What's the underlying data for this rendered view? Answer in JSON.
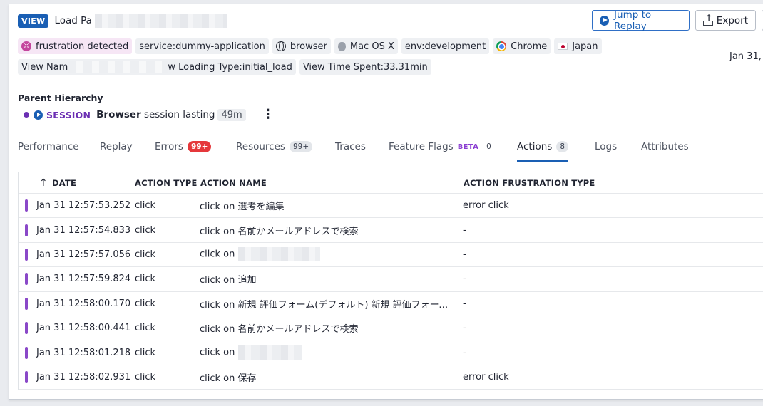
{
  "header": {
    "badge": "VIEW",
    "title": "Load Pa",
    "jump_to_replay": "Jump to Replay",
    "export": "Export",
    "date_right": "Jan 31, "
  },
  "tags_row1": [
    {
      "label": "frustration detected",
      "icon": "frustration-face-icon"
    },
    {
      "label": "service:dummy-application"
    },
    {
      "label": "browser",
      "icon": "globe-icon"
    },
    {
      "label": "Mac OS X",
      "icon": "apple-icon"
    },
    {
      "label": "env:development"
    },
    {
      "label": "Chrome",
      "icon": "chrome-icon"
    },
    {
      "label": "Japan",
      "icon": "japan-flag-icon"
    }
  ],
  "tags_row2": {
    "view_name_prefix": "View Nam",
    "view_name_suffix": "w Loading Type:",
    "loading_type": "initial_load",
    "time_spent_label": "View Time Spent:",
    "time_spent_value": "33.31min"
  },
  "hierarchy": {
    "title": "Parent Hierarchy",
    "session_label": "SESSION",
    "session_bold": "Browser",
    "session_desc": " session lasting",
    "duration": "49m"
  },
  "tabs": [
    {
      "label": "Performance"
    },
    {
      "label": "Replay"
    },
    {
      "label": "Errors",
      "count": "99+"
    },
    {
      "label": "Resources",
      "count": "99+"
    },
    {
      "label": "Traces"
    },
    {
      "label": "Feature Flags",
      "beta": "BETA",
      "count": "0"
    },
    {
      "label": "Actions",
      "count": "8"
    },
    {
      "label": "Logs"
    },
    {
      "label": "Attributes"
    }
  ],
  "table": {
    "headers": {
      "date": "DATE",
      "type": "ACTION TYPE",
      "name": "ACTION NAME",
      "frust": "ACTION FRUSTRATION TYPE"
    },
    "rows": [
      {
        "date": "Jan 31 12:57:53.252",
        "type": "click",
        "name": "click on 選考を編集",
        "frust": "error click"
      },
      {
        "date": "Jan 31 12:57:54.833",
        "type": "click",
        "name": "click on 名前かメールアドレスで検索",
        "frust": "-"
      },
      {
        "date": "Jan 31 12:57:57.056",
        "type": "click",
        "name": "click on ",
        "frust": "-"
      },
      {
        "date": "Jan 31 12:57:59.824",
        "type": "click",
        "name": "click on 追加",
        "frust": "-"
      },
      {
        "date": "Jan 31 12:58:00.170",
        "type": "click",
        "name": "click on 新規 評価フォーム(デフォルト) 新規 評価フォーム…",
        "frust": "-"
      },
      {
        "date": "Jan 31 12:58:00.441",
        "type": "click",
        "name": "click on 名前かメールアドレスで検索",
        "frust": "-"
      },
      {
        "date": "Jan 31 12:58:01.218",
        "type": "click",
        "name": "click on ",
        "frust": "-"
      },
      {
        "date": "Jan 31 12:58:02.931",
        "type": "click",
        "name": "click on 保存",
        "frust": "error click"
      }
    ]
  },
  "colors": {
    "accent": "#1a5fb4",
    "action_bar": "#8a48c8",
    "errors_badge": "#e5383b",
    "session": "#6b2fb3"
  }
}
